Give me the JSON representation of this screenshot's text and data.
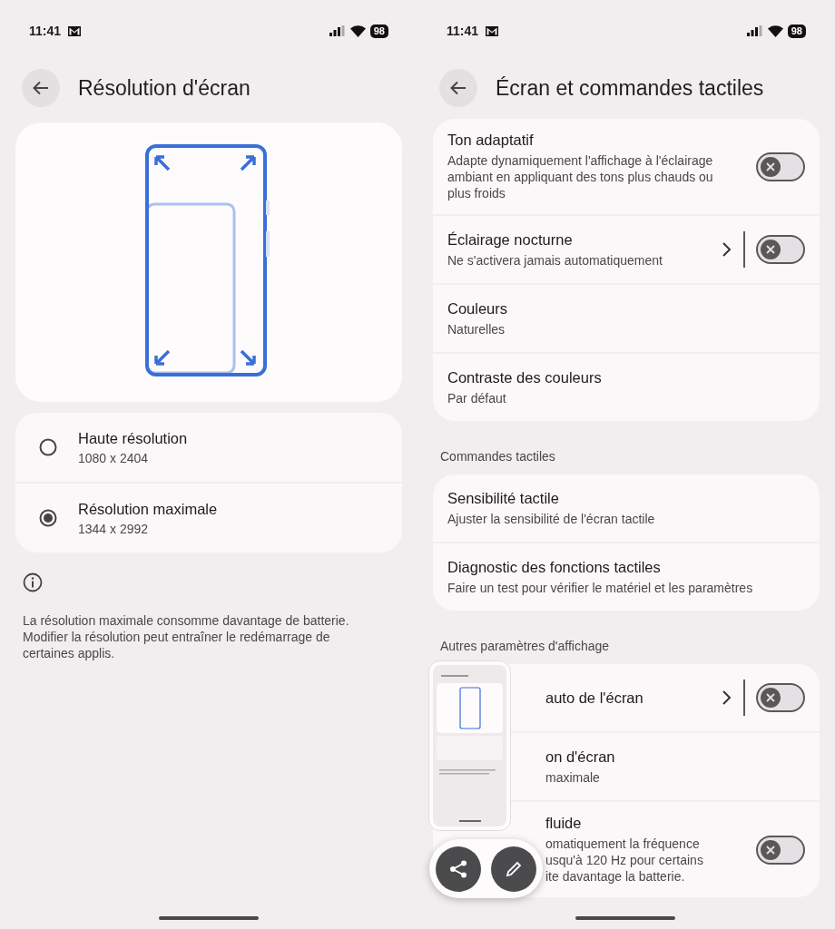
{
  "left_screen": {
    "status_bar": {
      "time": "11:41",
      "battery": "98"
    },
    "title": "Résolution d'écran",
    "options": [
      {
        "label": "Haute résolution",
        "detail": "1080 x 2404",
        "selected": false
      },
      {
        "label": "Résolution maximale",
        "detail": "1344 x 2992",
        "selected": true
      }
    ],
    "note": "La résolution maximale consomme davantage de batterie.\nModifier la résolution peut entraîner le redémarrage de\ncertaines applis."
  },
  "right_screen": {
    "status_bar": {
      "time": "11:41",
      "battery": "98"
    },
    "title": "Écran et commandes tactiles",
    "groups": [
      {
        "items": [
          {
            "kind": "switch",
            "title": "Ton adaptatif",
            "summary": "Adapte dynamiquement l'affichage à l'éclairage\nambiant en appliquant des tons plus chauds ou\nplus froids",
            "on": false
          },
          {
            "kind": "split",
            "title": "Éclairage nocturne",
            "summary": "Ne s'activera jamais automatiquement",
            "on": false
          },
          {
            "kind": "link",
            "title": "Couleurs",
            "summary": "Naturelles"
          },
          {
            "kind": "link",
            "title": "Contraste des couleurs",
            "summary": "Par défaut"
          }
        ]
      },
      {
        "header": "Commandes tactiles",
        "items": [
          {
            "kind": "link",
            "title": "Sensibilité tactile",
            "summary": "Ajuster la sensibilité de l'écran tactile"
          },
          {
            "kind": "link",
            "title": "Diagnostic des fonctions tactiles",
            "summary": "Faire un test pour vérifier le matériel et les paramètres"
          }
        ]
      },
      {
        "header": "Autres paramètres d'affichage",
        "items": [
          {
            "kind": "split",
            "title": "auto de l'écran",
            "on": false,
            "covered": true
          },
          {
            "kind": "link",
            "title": "on d'écran",
            "summary": "maximale",
            "covered": true
          },
          {
            "kind": "switch",
            "title": "fluide",
            "summary": "omatiquement la fréquence\nusqu'à 120 Hz pour certains\nite davantage la batterie.",
            "on": false,
            "covered": true
          }
        ]
      }
    ]
  }
}
